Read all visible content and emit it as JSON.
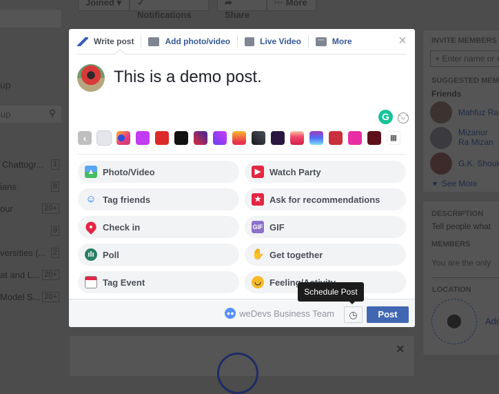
{
  "background": {
    "top_buttons": [
      "Joined",
      "Notifications",
      "Share",
      "More"
    ],
    "left_sidebar": {
      "partial_heading": "up",
      "search_placeholder": "up",
      "groups": [
        {
          "label": "Chattogr...",
          "count": "1"
        },
        {
          "label": "ians",
          "count": "8"
        },
        {
          "label": "our",
          "count": "20+"
        },
        {
          "label": "",
          "count": "9"
        },
        {
          "label": "versities (...",
          "count": "2"
        },
        {
          "label": "at and L...",
          "count": "20+"
        },
        {
          "label": "Model S...",
          "count": "20+"
        }
      ]
    },
    "right_sidebar": {
      "invite_heading": "INVITE MEMBERS",
      "invite_placeholder": "Enter name or e",
      "suggested_heading": "SUGGESTED MEM",
      "friends_label": "Friends",
      "friends": [
        "Mahfuz Ra",
        "Mizanur Ra Mizan",
        "G.K. Shouk"
      ],
      "see_more": "See More",
      "description_heading": "DESCRIPTION",
      "description_text": "Tell people what",
      "members_heading": "MEMBERS",
      "members_text": "You are the only",
      "location_heading": "LOCATION",
      "location_add": "Add"
    }
  },
  "composer": {
    "tabs": [
      {
        "label": "Write post",
        "icon": "pencil-icon"
      },
      {
        "label": "Add photo/video",
        "icon": "camera-icon"
      },
      {
        "label": "Live Video",
        "icon": "video-camera-icon"
      },
      {
        "label": "More",
        "icon": "more-icon"
      }
    ],
    "post_text": "This is a demo post.",
    "grammarly_letter": "G",
    "background_colors": [
      "#e4e6eb",
      "image",
      "#c13cf2",
      "#dc2a2a",
      "#111111",
      "#8b2a8f",
      "#9c3bf0",
      "#f7a21f",
      "#2a2c33",
      "#2a1740",
      "#f14b6b",
      "#4f6ef7",
      "#c9303b",
      "#e82ea5",
      "#5d0f1a"
    ],
    "options": [
      {
        "label": "Photo/Video",
        "icon": "photo-icon",
        "color": "#45bd62"
      },
      {
        "label": "Watch Party",
        "icon": "popcorn-icon",
        "color": "#e42645"
      },
      {
        "label": "Tag friends",
        "icon": "tag-friends-icon",
        "color": "#1877f2"
      },
      {
        "label": "Ask for recommendations",
        "icon": "recommendation-icon",
        "color": "#e42645"
      },
      {
        "label": "Check in",
        "icon": "location-pin-icon",
        "color": "#e42645"
      },
      {
        "label": "GIF",
        "icon": "gif-icon",
        "color": "#8c72cb"
      },
      {
        "label": "Poll",
        "icon": "poll-icon",
        "color": "#2a7f62"
      },
      {
        "label": "Get together",
        "icon": "wave-hand-icon",
        "color": "#1877f2"
      },
      {
        "label": "Tag Event",
        "icon": "calendar-icon",
        "color": "#e42645"
      },
      {
        "label": "Feeling/Activity",
        "icon": "smiley-icon",
        "color": "#f7b928"
      }
    ],
    "footer": {
      "audience": "weDevs Business Team",
      "schedule_tooltip": "Schedule Post",
      "post_button": "Post"
    }
  }
}
